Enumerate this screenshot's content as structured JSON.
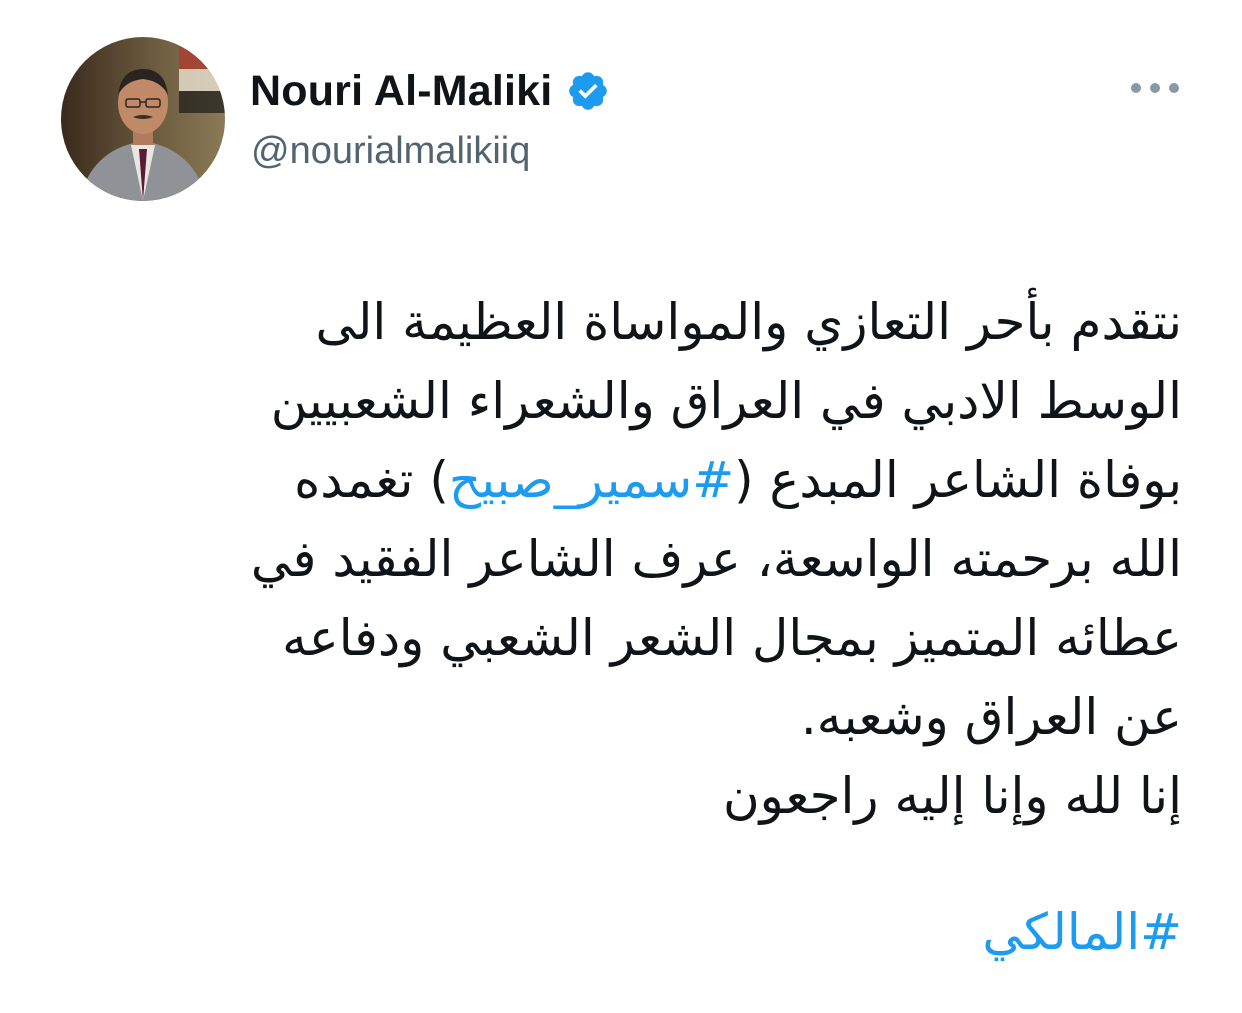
{
  "author": {
    "name": "Nouri Al-Maliki",
    "handle": "@nourialmalikiiq",
    "verified": true
  },
  "tweet": {
    "lines": [
      "نتقدم بأحر التعازي والمواساة العظيمة الى",
      "الوسط الادبي في العراق والشعراء الشعبيين",
      {
        "before": "بوفاة الشاعر المبدع (",
        "hashtag": "#سمير_صبيح",
        "after": ") تغمده"
      },
      "الله برحمته الواسعة، عرف الشاعر الفقيد في",
      "عطائه المتميز بمجال الشعر الشعبي ودفاعه",
      "عن العراق وشعبه.",
      "إنا لله وإنا إليه راجعون"
    ],
    "closing_hashtag": "#المالكي"
  },
  "icons": {
    "verified": "verified-badge-icon",
    "more": "more-horizontal-icon"
  },
  "colors": {
    "link": "#1d9bf0",
    "verified": "#1d9bf0",
    "handle": "#536471",
    "text": "#0f1419",
    "more_dots": "#8899a6"
  }
}
